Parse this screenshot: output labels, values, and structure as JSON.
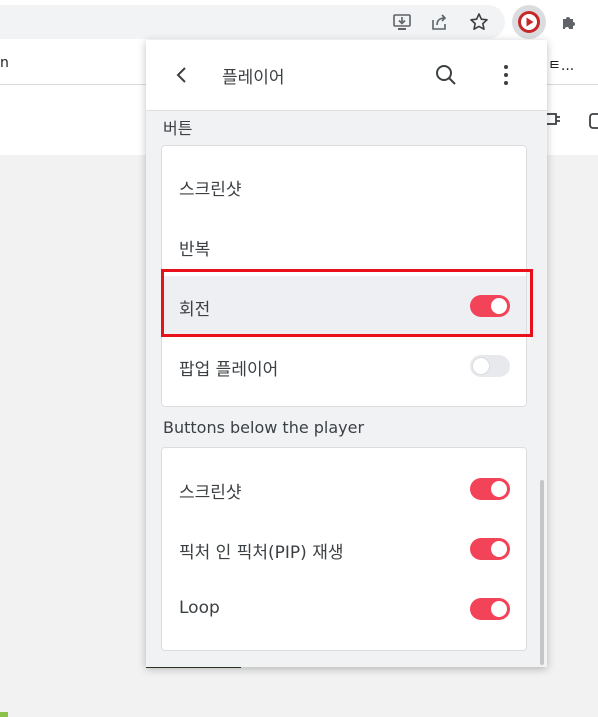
{
  "browser": {
    "bookmark_left": "n",
    "bookmark_right": "ㅌ..."
  },
  "popup": {
    "title": "플레이어",
    "section_buttons": {
      "label": "버튼",
      "rows": [
        {
          "label": "스크린샷"
        },
        {
          "label": "반복"
        },
        {
          "label": "회전",
          "toggle": "on"
        },
        {
          "label": "팝업 플레이어",
          "toggle": "off"
        }
      ]
    },
    "section_below": {
      "label": "Buttons below the player",
      "rows": [
        {
          "label": "스크린샷",
          "toggle": "on"
        },
        {
          "label": "픽처 인 픽처(PIP) 재생",
          "toggle": "on"
        },
        {
          "label": "Loop",
          "toggle": "on"
        }
      ]
    }
  },
  "colors": {
    "toggle_on": "#f34359",
    "toggle_off": "#e8e9ec",
    "highlight_border": "#e8101a"
  }
}
